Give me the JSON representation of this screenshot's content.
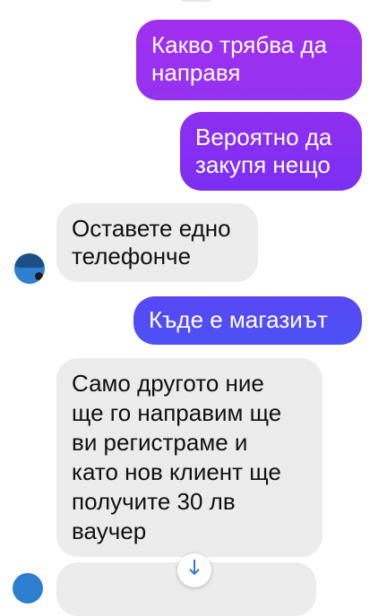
{
  "conversation": {
    "messages": [
      {
        "direction": "outgoing",
        "text": "Какво трябва да\nнаправя"
      },
      {
        "direction": "outgoing",
        "text": "Вероятно да\nзакупя нещо"
      },
      {
        "direction": "incoming",
        "text": "Оставете едно\nтелефонче"
      },
      {
        "direction": "outgoing",
        "text": "Къде е магазиът"
      },
      {
        "direction": "incoming",
        "text": "Само другото ние\nще го направим ще\nви регистраме и\nкато нов клиент ще\nполучите 30 лв\nваучер"
      }
    ]
  },
  "colors": {
    "outgoing_top": "#a030f0",
    "outgoing_mid": "#7a2ff2",
    "outgoing_bottom": "#4a4ff5",
    "incoming_bg": "#ececec",
    "avatar": "#2f7fd0"
  },
  "icons": {
    "scroll_down": "arrow-down-icon"
  }
}
